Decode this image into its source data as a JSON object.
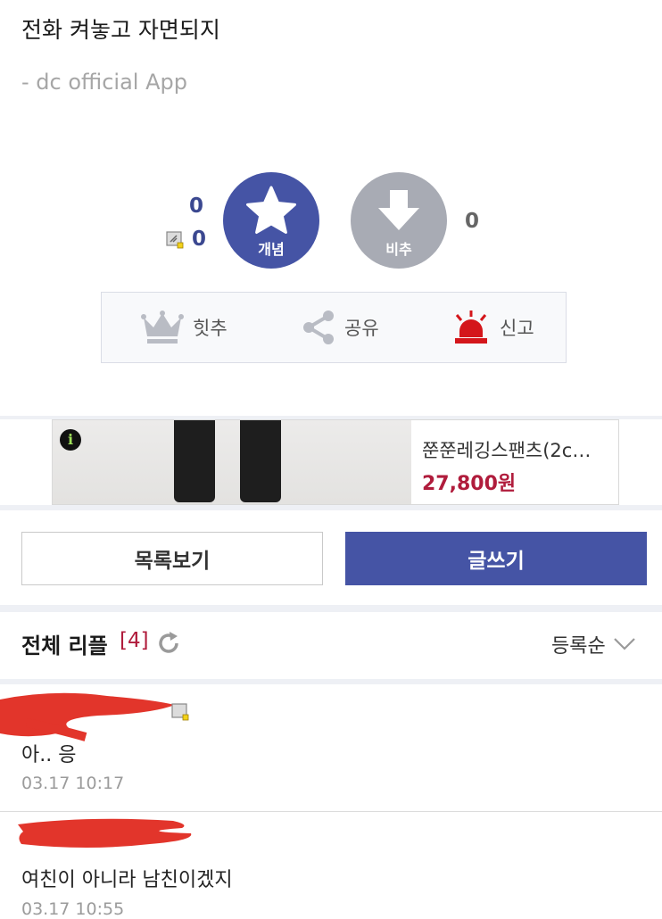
{
  "post": {
    "title": "전화 켜놓고 자면되지",
    "app_signature": "- dc official App"
  },
  "votes": {
    "up_count": "0",
    "fixed_up_count": "0",
    "up_label": "개념",
    "down_label": "비추",
    "down_count": "0"
  },
  "actions": {
    "hit": "힛추",
    "share": "공유",
    "report": "신고"
  },
  "ad": {
    "product_name": "쭌쭌레깅스팬츠(2c…",
    "price": "27,800원",
    "info_badge": "i"
  },
  "buttons": {
    "list": "목록보기",
    "write": "글쓰기"
  },
  "comments": {
    "heading": "전체 리플",
    "count": "[4]",
    "sort_label": "등록순",
    "items": [
      {
        "text": "아.. 응",
        "time": "03.17 10:17"
      },
      {
        "text": "여친이 아니라 남친이겠지",
        "time": "03.17 10:55"
      }
    ]
  },
  "colors": {
    "accent": "#4554a5",
    "price": "#b01c3c",
    "report_icon": "#d4161b"
  }
}
